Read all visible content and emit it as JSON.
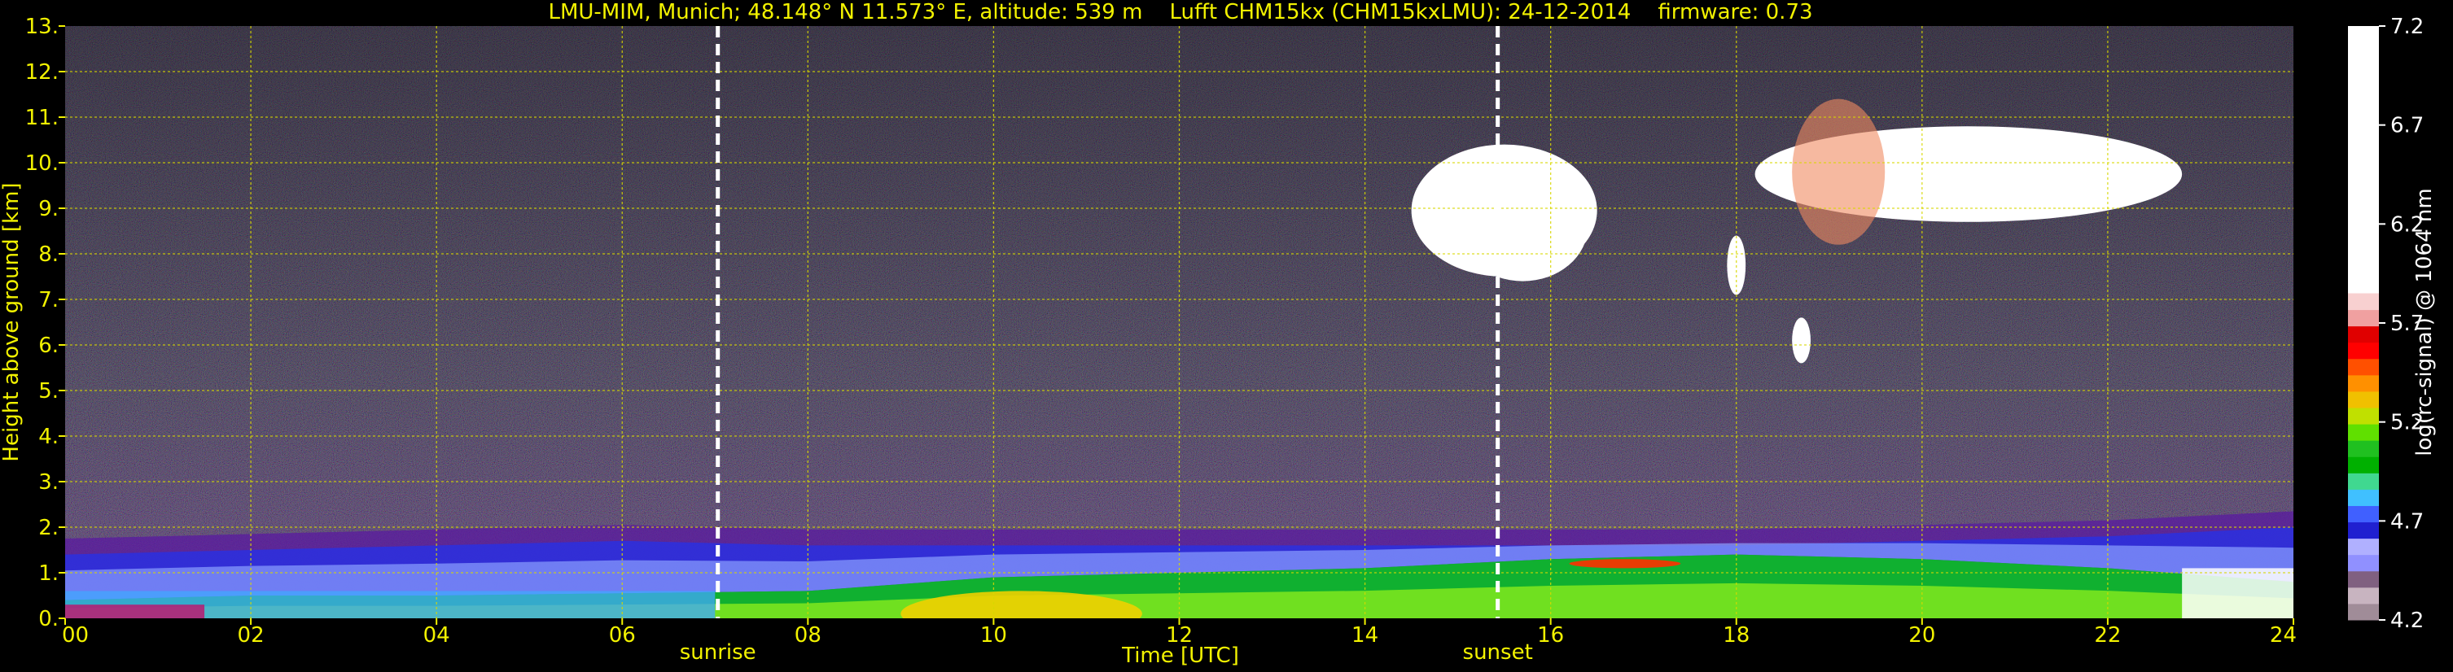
{
  "chart_data": {
    "type": "heatmap",
    "title": "LMU-MIM, Munich; 48.148° N 11.573° E, altitude: 539 m    Lufft CHM15kx (CHM15kxLMU): 24-12-2014    firmware: 0.73",
    "xlabel": "Time [UTC]",
    "ylabel": "Height above ground [km]",
    "x_range": [
      0,
      24
    ],
    "y_range": [
      0,
      13
    ],
    "x_ticks": [
      "00",
      "02",
      "04",
      "06",
      "08",
      "10",
      "12",
      "14",
      "16",
      "18",
      "20",
      "22",
      "24"
    ],
    "y_ticks": [
      "0.",
      "1.",
      "2.",
      "3.",
      "4.",
      "5.",
      "6.",
      "7.",
      "8.",
      "9.",
      "10.",
      "11.",
      "12.",
      "13."
    ],
    "grid": true,
    "grid_color": "#d8d800",
    "markers": [
      {
        "label": "sunrise",
        "x": 7.03
      },
      {
        "label": "sunset",
        "x": 15.43
      }
    ],
    "colorbar": {
      "label": "log(rc-signal) @ 1064 nm",
      "range": [
        4.2,
        7.2
      ],
      "ticks": [
        "7.2",
        "6.7",
        "6.2",
        "5.7",
        "5.2",
        "4.7",
        "4.2"
      ],
      "colors": [
        "#a08c98",
        "#c8b4c0",
        "#806080",
        "#9090ff",
        "#b0b0ff",
        "#2020d0",
        "#4060ff",
        "#40c0ff",
        "#40d890",
        "#00b000",
        "#20c020",
        "#60e000",
        "#c0e000",
        "#f0c000",
        "#ff9000",
        "#ff5000",
        "#ff0000",
        "#e00000",
        "#f0a0a0",
        "#f8d0d0",
        "#ffffff"
      ]
    },
    "layers": [
      {
        "name": "surface aerosol layer",
        "x": [
          0,
          24
        ],
        "y_top": [
          0.4,
          0.5,
          0.5,
          0.55,
          0.6,
          0.9,
          1.0,
          1.1,
          1.3,
          1.4,
          1.3,
          1.1,
          0.8
        ]
      },
      {
        "name": "residual layer",
        "x": [
          0,
          24
        ],
        "y_top": [
          1.4,
          1.5,
          1.6,
          1.7,
          1.6,
          1.6,
          1.6,
          1.6,
          1.6,
          1.6,
          1.7,
          1.8,
          2.0
        ]
      },
      {
        "name": "cloud 1",
        "x": [
          14.5,
          16.5
        ],
        "y": [
          7.5,
          10.4
        ]
      },
      {
        "name": "cloud 2",
        "x": [
          18.2,
          22.8
        ],
        "y": [
          8.7,
          10.8
        ]
      },
      {
        "name": "virga",
        "x": [
          17.9,
          18.1
        ],
        "y": [
          7.1,
          8.4
        ]
      },
      {
        "name": "cloud fragment",
        "x": [
          18.6,
          18.8
        ],
        "y": [
          5.6,
          6.6
        ]
      }
    ]
  }
}
